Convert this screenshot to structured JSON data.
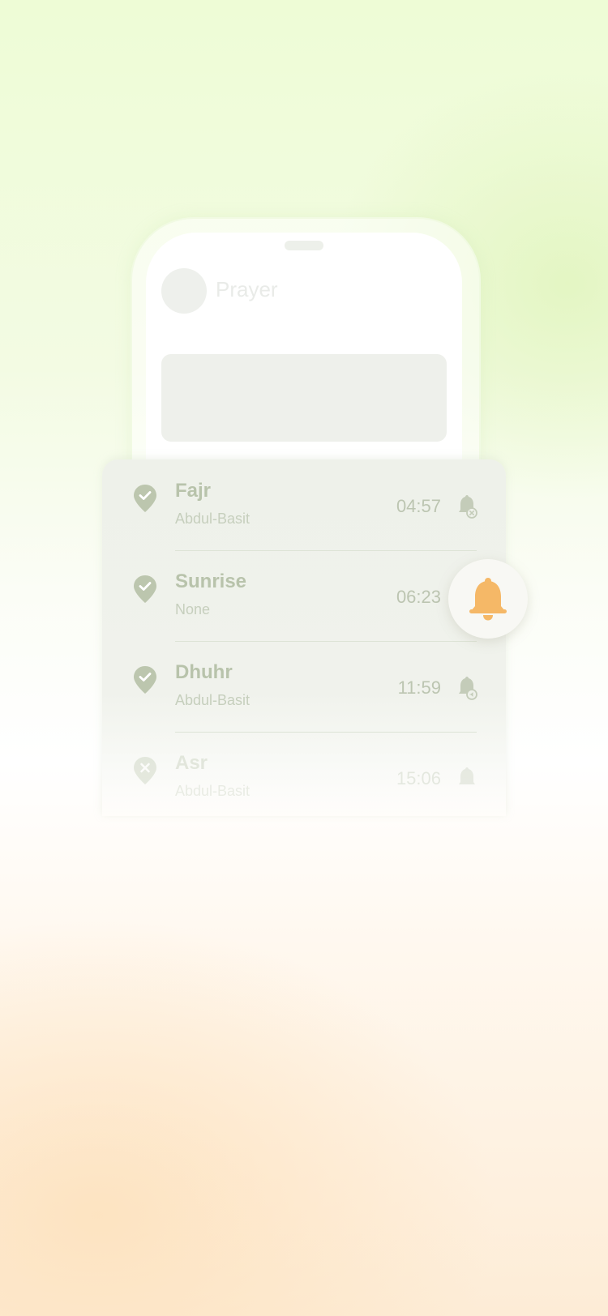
{
  "phone": {
    "title": "Prayer"
  },
  "prayers": [
    {
      "name": "Fajr",
      "reciter": "Abdul-Basit",
      "time": "04:57",
      "status": "check",
      "alert": "bell-muted"
    },
    {
      "name": "Sunrise",
      "reciter": "None",
      "time": "06:23",
      "status": "check",
      "alert": "bell-active"
    },
    {
      "name": "Dhuhr",
      "reciter": "Abdul-Basit",
      "time": "11:59",
      "status": "check",
      "alert": "bell-sound"
    },
    {
      "name": "Asr",
      "reciter": "Abdul-Basit",
      "time": "15:06",
      "status": "cross",
      "alert": "bell"
    }
  ],
  "colors": {
    "accent_bell": "#f5b867",
    "pin": "#bcc6ae",
    "text_muted": "#b8c3ab"
  },
  "icons": {
    "status_check": "map-pin-check-icon",
    "status_cross": "map-pin-x-icon",
    "bell": "bell-icon"
  }
}
